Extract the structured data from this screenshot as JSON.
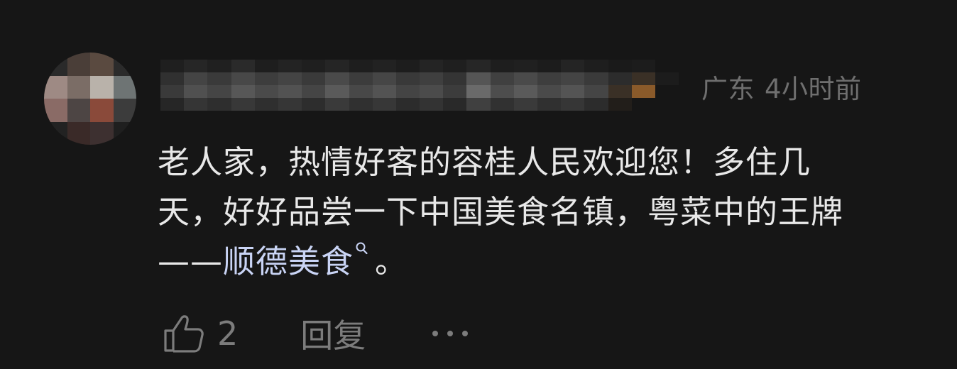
{
  "comment": {
    "location": "广东",
    "time_ago": "4小时前",
    "text_line1": "老人家，热情好客的容桂人民欢迎您！多住几",
    "text_line2": "天，好好品尝一下中国美食名镇，粤菜中的王牌",
    "text_line3_prefix": "——",
    "text_line3_link": "顺德美食",
    "text_line3_suffix": "。",
    "link_icon": "search-icon"
  },
  "actions": {
    "like_icon": "thumbs-up-icon",
    "like_count": "2",
    "reply_label": "回复",
    "more_icon": "more-dots-icon"
  },
  "colors": {
    "background": "#161616",
    "text": "#e8e8e8",
    "muted": "#7c7c7c",
    "link": "#c9d4f5"
  }
}
